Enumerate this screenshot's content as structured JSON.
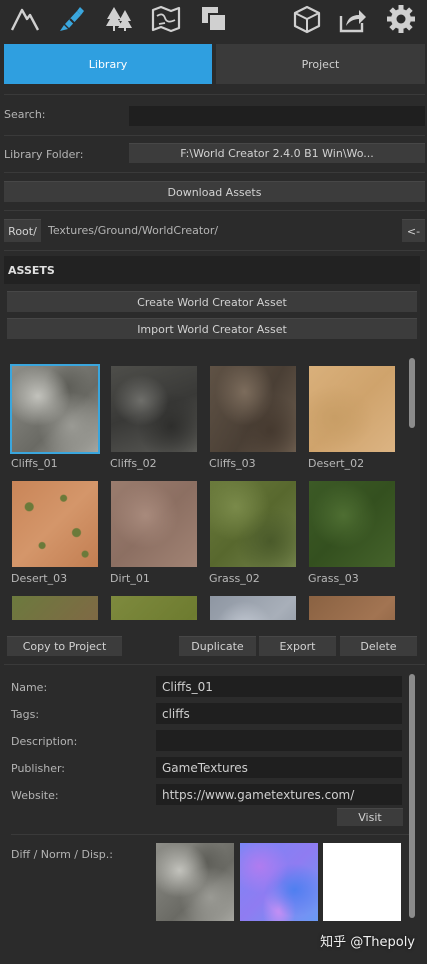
{
  "toolbar": {
    "icons": [
      "mountain-icon",
      "brush-icon",
      "trees-icon",
      "map-icon",
      "copy-icon",
      "cube-icon",
      "share-icon",
      "gear-icon"
    ],
    "active": "brush-icon",
    "accent": "#3aa6dd"
  },
  "tabs": [
    {
      "label": "Library",
      "active": true
    },
    {
      "label": "Project",
      "active": false
    }
  ],
  "search": {
    "label": "Search:",
    "value": ""
  },
  "library_folder": {
    "label": "Library Folder:",
    "value": "F:\\World Creator 2.4.0 B1 Win\\Wo..."
  },
  "download_label": "Download Assets",
  "path": {
    "root_label": "Root/",
    "current": "Textures/Ground/WorldCreator/",
    "back_label": "<-"
  },
  "assets": {
    "header": "ASSETS",
    "create_label": "Create World Creator Asset",
    "import_label": "Import World Creator Asset",
    "items": [
      {
        "name": "Cliffs_01",
        "selected": true
      },
      {
        "name": "Cliffs_02"
      },
      {
        "name": "Cliffs_03"
      },
      {
        "name": "Desert_02"
      },
      {
        "name": "Desert_03"
      },
      {
        "name": "Dirt_01"
      },
      {
        "name": "Grass_02"
      },
      {
        "name": "Grass_03"
      }
    ]
  },
  "actions": {
    "copy": "Copy to Project",
    "duplicate": "Duplicate",
    "export": "Export",
    "delete": "Delete"
  },
  "details": {
    "name_label": "Name:",
    "name": "Cliffs_01",
    "tags_label": "Tags:",
    "tags": "cliffs",
    "description_label": "Description:",
    "description": "",
    "publisher_label": "Publisher:",
    "publisher": "GameTextures",
    "website_label": "Website:",
    "website": "https://www.gametextures.com/",
    "visit_label": "Visit",
    "maps_label": "Diff / Norm / Disp.:"
  },
  "watermark": "知乎 @Thepoly"
}
